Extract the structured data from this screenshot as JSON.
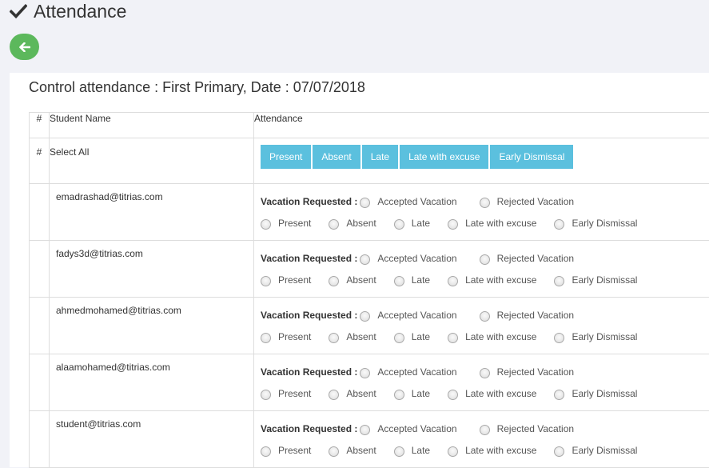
{
  "header": {
    "title": "Attendance"
  },
  "card_title": "Control attendance : First Primary, Date : 07/07/2018",
  "table": {
    "col_num": "#",
    "col_name": "Student Name",
    "col_attendance": "Attendance",
    "select_all_num": "#",
    "select_all_label": "Select All",
    "buttons": [
      "Present",
      "Absent",
      "Late",
      "Late with excuse",
      "Early Dismissal"
    ]
  },
  "vacation_label": "Vacation Requested :",
  "vacation_options": [
    "Accepted Vacation",
    "Rejected Vacation"
  ],
  "status_options": [
    "Present",
    "Absent",
    "Late",
    "Late with excuse",
    "Early Dismissal"
  ],
  "students": [
    {
      "name": "emadrashad@titrias.com"
    },
    {
      "name": "fadys3d@titrias.com"
    },
    {
      "name": "ahmedmohamed@titrias.com"
    },
    {
      "name": "alaamohamed@titrias.com"
    },
    {
      "name": "student@titrias.com"
    }
  ],
  "colors": {
    "success": "#5cb85c",
    "info": "#5bc0de"
  }
}
